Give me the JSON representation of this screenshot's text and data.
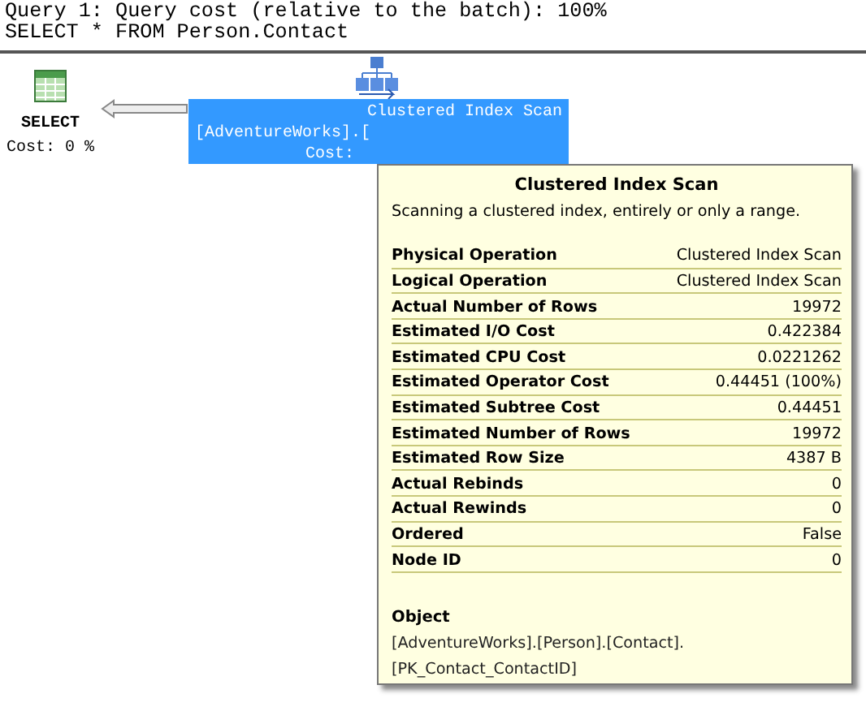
{
  "header": {
    "lines": [
      "Query 1: Query cost (relative to the batch): 100%",
      "SELECT * FROM Person.Contact"
    ]
  },
  "nodes": [
    {
      "kind": "select",
      "lines": [
        "SELECT",
        "Cost: 0 %"
      ],
      "selected": false
    },
    {
      "kind": "scan",
      "lines": [
        "Clustered Index Scan",
        "[AdventureWorks].[",
        "Cost:"
      ],
      "selected": true
    }
  ],
  "tooltip": {
    "title": "Clustered Index Scan",
    "description": "Scanning a clustered index, entirely or only a range.",
    "properties": [
      {
        "name": "Physical Operation",
        "value": "Clustered Index Scan"
      },
      {
        "name": "Logical Operation",
        "value": "Clustered Index Scan"
      },
      {
        "name": "Actual Number of Rows",
        "value": "19972"
      },
      {
        "name": "Estimated I/O Cost",
        "value": "0.422384"
      },
      {
        "name": "Estimated CPU Cost",
        "value": "0.0221262"
      },
      {
        "name": "Estimated Operator Cost",
        "value": "0.44451 (100%)"
      },
      {
        "name": "Estimated Subtree Cost",
        "value": "0.44451"
      },
      {
        "name": "Estimated Number of Rows",
        "value": "19972"
      },
      {
        "name": "Estimated Row Size",
        "value": "4387 B"
      },
      {
        "name": "Actual Rebinds",
        "value": "0"
      },
      {
        "name": "Actual Rewinds",
        "value": "0"
      },
      {
        "name": "Ordered",
        "value": "False"
      },
      {
        "name": "Node ID",
        "value": "0"
      }
    ],
    "object": {
      "heading": "Object",
      "lines": [
        "[AdventureWorks].[Person].[Contact].",
        "[PK_Contact_ContactID]"
      ]
    }
  }
}
